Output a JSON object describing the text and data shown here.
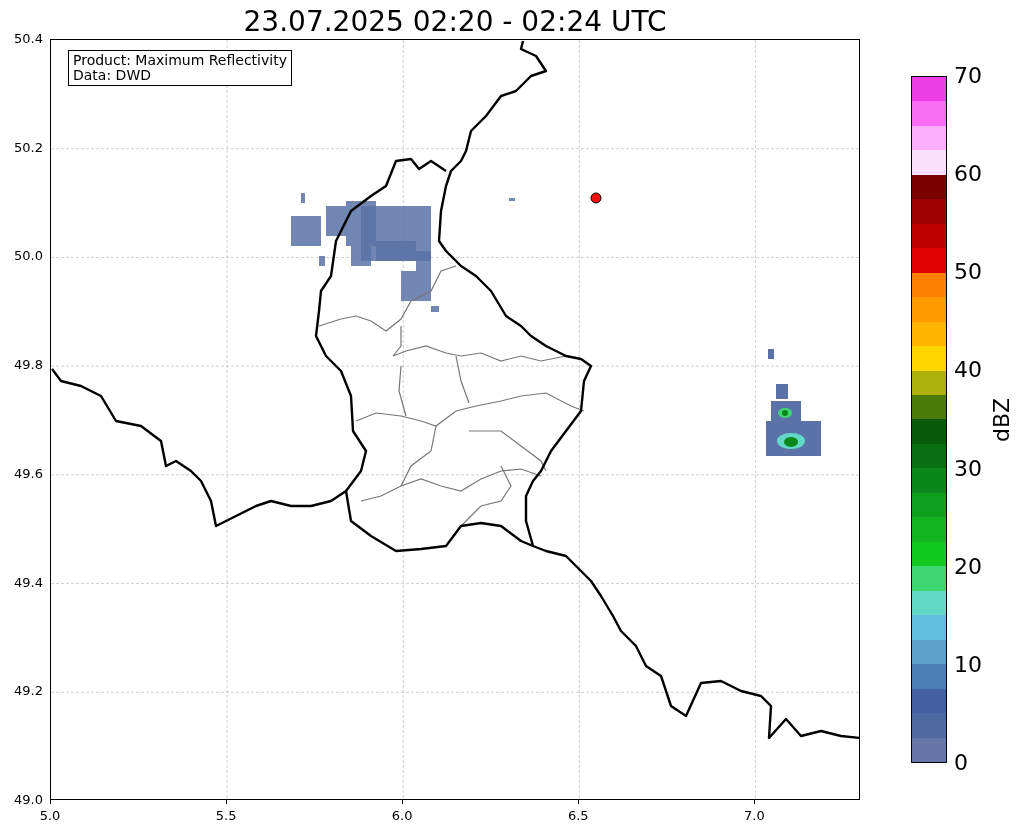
{
  "title": "23.07.2025 02:20 - 02:24 UTC",
  "info_box": [
    "Product: Maximum Reflectivity",
    "Data: DWD"
  ],
  "x_ticks": [
    "5.0",
    "5.5",
    "6.0",
    "6.5",
    "7.0"
  ],
  "y_ticks": [
    "50.4",
    "50.2",
    "50.0",
    "49.8",
    "49.6",
    "49.4",
    "49.2",
    "49.0"
  ],
  "colorbar": {
    "label": "dBZ",
    "ticks": [
      "70",
      "60",
      "50",
      "40",
      "30",
      "20",
      "10",
      "0"
    ],
    "segments": [
      {
        "color": "#6477a8"
      },
      {
        "color": "#5068a0"
      },
      {
        "color": "#4460a0"
      },
      {
        "color": "#4b7eb4"
      },
      {
        "color": "#5aa0c8"
      },
      {
        "color": "#62bedc"
      },
      {
        "color": "#62d8c8"
      },
      {
        "color": "#3ed670"
      },
      {
        "color": "#12c920"
      },
      {
        "color": "#10b520"
      },
      {
        "color": "#0e9e1e"
      },
      {
        "color": "#0b871b"
      },
      {
        "color": "#0a6e12"
      },
      {
        "color": "#0a5a0a"
      },
      {
        "color": "#4a7a0a"
      },
      {
        "color": "#afb00a"
      },
      {
        "color": "#ffd700"
      },
      {
        "color": "#ffb500"
      },
      {
        "color": "#ff9b00"
      },
      {
        "color": "#ff7f00"
      },
      {
        "color": "#e00000"
      },
      {
        "color": "#c00000"
      },
      {
        "color": "#9c0000"
      },
      {
        "color": "#780000"
      },
      {
        "color": "#fde0fd"
      },
      {
        "color": "#fbaefb"
      },
      {
        "color": "#f96ef5"
      },
      {
        "color": "#ee3ee8"
      }
    ]
  }
}
